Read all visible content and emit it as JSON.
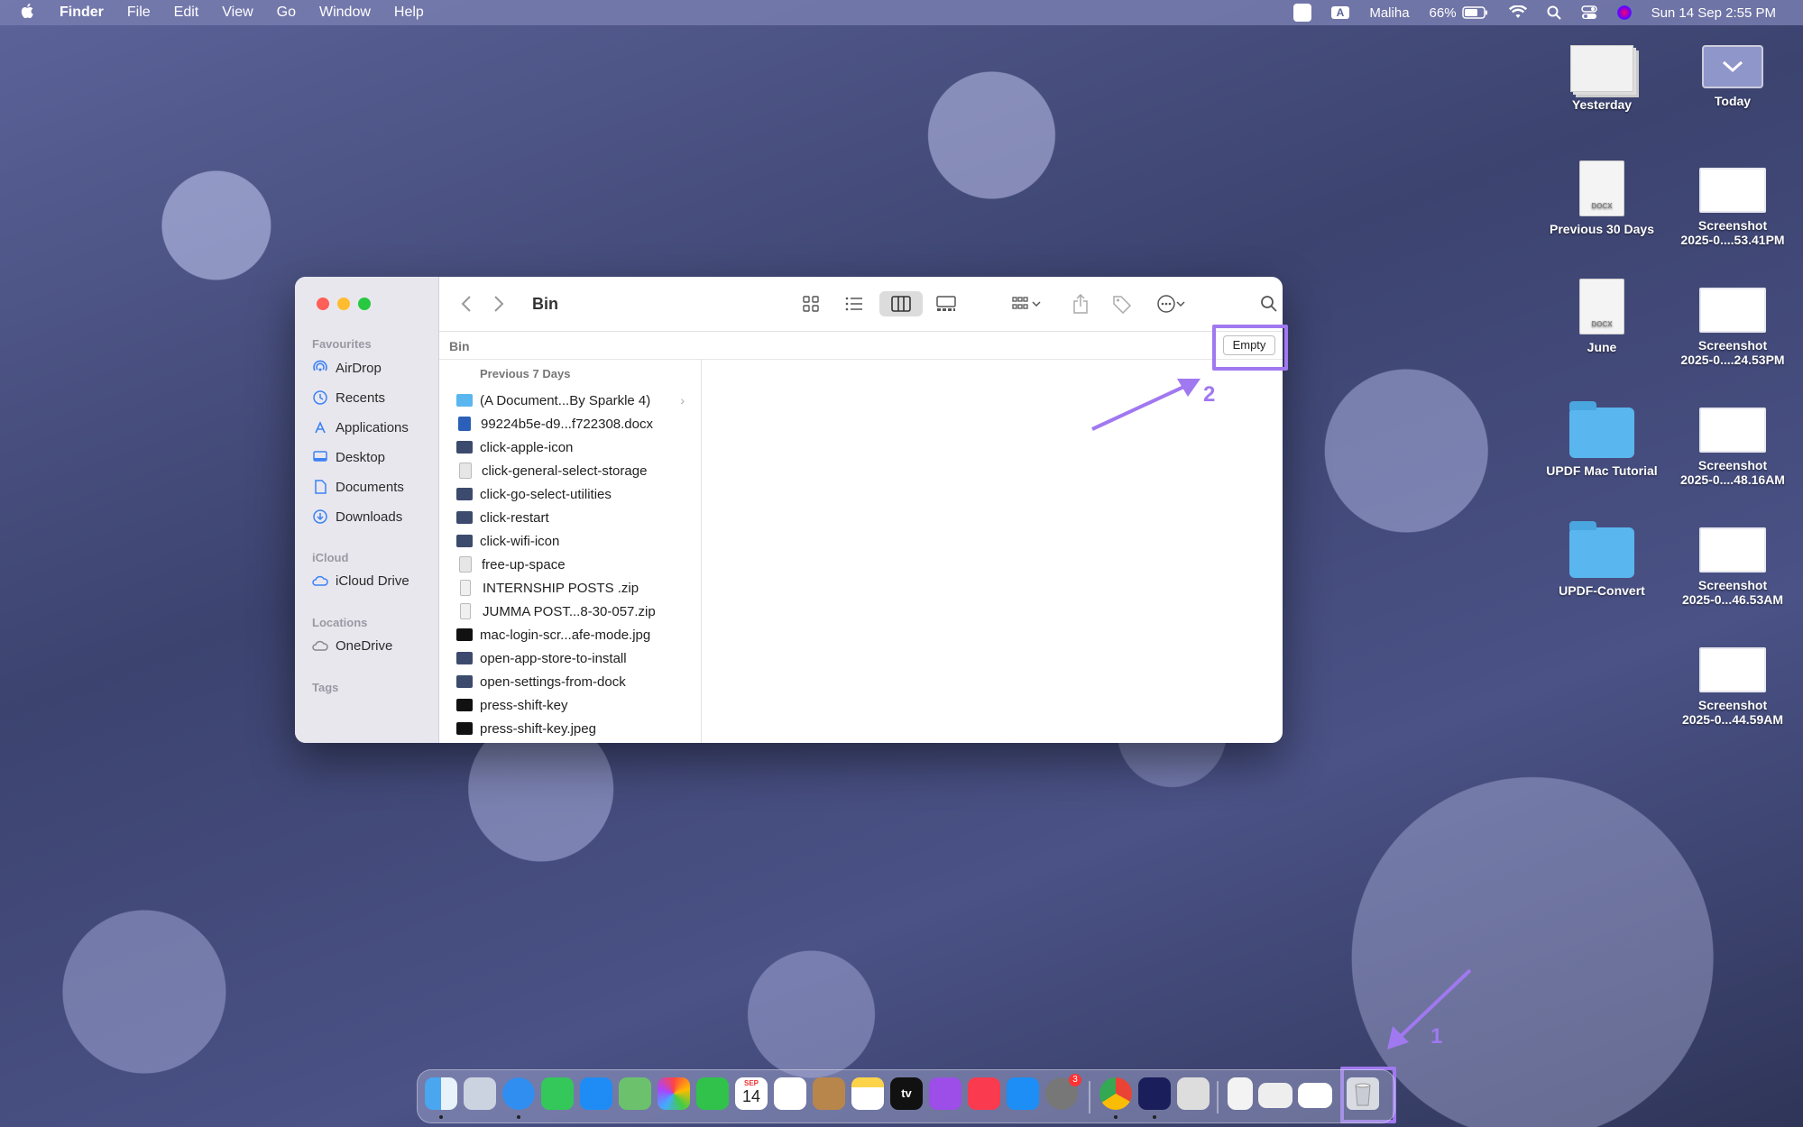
{
  "menubar": {
    "app": "Finder",
    "menus": [
      "File",
      "Edit",
      "View",
      "Go",
      "Window",
      "Help"
    ],
    "input_badge": "A",
    "user": "Maliha",
    "battery": "66%",
    "datetime": "Sun 14 Sep  2:55 PM"
  },
  "desktop": {
    "items": [
      {
        "name": "Yesterday",
        "sub": ""
      },
      {
        "name": "Today",
        "sub": ""
      },
      {
        "name": "Previous 30 Days",
        "sub": ""
      },
      {
        "name": "Screenshot",
        "sub": "2025-0....53.41PM"
      },
      {
        "name": "June",
        "sub": ""
      },
      {
        "name": "Screenshot",
        "sub": "2025-0....24.53PM"
      },
      {
        "name": "UPDF Mac Tutorial",
        "sub": ""
      },
      {
        "name": "Screenshot",
        "sub": "2025-0....48.16AM"
      },
      {
        "name": "UPDF-Convert",
        "sub": ""
      },
      {
        "name": "Screenshot",
        "sub": "2025-0...46.53AM"
      },
      {
        "name": "Screenshot",
        "sub": "2025-0...44.59AM"
      }
    ]
  },
  "finder": {
    "title": "Bin",
    "path_crumb": "Bin",
    "empty_button": "Empty",
    "sidebar": {
      "favourites_heading": "Favourites",
      "favourites": [
        "AirDrop",
        "Recents",
        "Applications",
        "Desktop",
        "Documents",
        "Downloads"
      ],
      "icloud_heading": "iCloud",
      "icloud": [
        "iCloud Drive"
      ],
      "locations_heading": "Locations",
      "locations": [
        "OneDrive"
      ],
      "tags_heading": "Tags"
    },
    "column_heading": "Previous 7 Days",
    "files": [
      {
        "name": "(A Document...By Sparkle 4)",
        "icon": "folder-icon"
      },
      {
        "name": "99224b5e-d9...f722308.docx",
        "icon": "word-doc-icon"
      },
      {
        "name": "click-apple-icon",
        "icon": "image-icon"
      },
      {
        "name": "click-general-select-storage",
        "icon": "document-icon"
      },
      {
        "name": "click-go-select-utilities",
        "icon": "image-icon"
      },
      {
        "name": "click-restart",
        "icon": "image-icon"
      },
      {
        "name": "click-wifi-icon",
        "icon": "image-icon"
      },
      {
        "name": "free-up-space",
        "icon": "document-icon"
      },
      {
        "name": "INTERNSHIP POSTS .zip",
        "icon": "zip-icon"
      },
      {
        "name": "JUMMA POST...8-30-057.zip",
        "icon": "zip-icon"
      },
      {
        "name": "mac-login-scr...afe-mode.jpg",
        "icon": "dark-image-icon"
      },
      {
        "name": "open-app-store-to-install",
        "icon": "image-icon"
      },
      {
        "name": "open-settings-from-dock",
        "icon": "image-icon"
      },
      {
        "name": "press-shift-key",
        "icon": "dark-image-icon"
      },
      {
        "name": "press-shift-key.jpeg",
        "icon": "dark-image-icon"
      }
    ]
  },
  "annotations": {
    "label_1": "1",
    "label_2": "2",
    "color": "#a078f0"
  },
  "dock": {
    "calendar_month": "SEP",
    "calendar_day": "14",
    "settings_badge": "3",
    "tv_label": "tv"
  }
}
